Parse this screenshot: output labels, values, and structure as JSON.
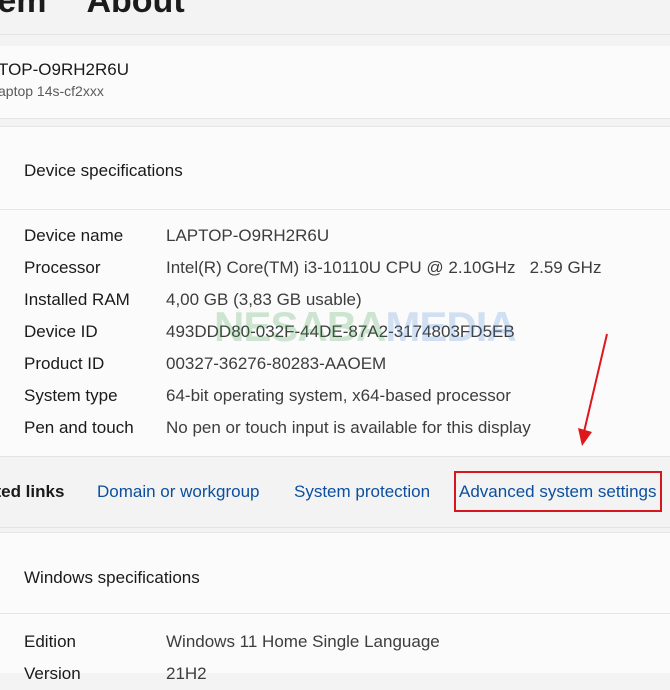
{
  "header": {
    "breadcrumb_parent": "tem",
    "breadcrumb_current": "About"
  },
  "device": {
    "name": "TOP-O9RH2R6U",
    "model": "aptop 14s-cf2xxx"
  },
  "device_specs": {
    "title": "Device specifications",
    "rows": [
      {
        "label": "Device name",
        "value": "LAPTOP-O9RH2R6U"
      },
      {
        "label": "Processor",
        "value": "Intel(R) Core(TM) i3-10110U CPU @ 2.10GHz   2.59 GHz"
      },
      {
        "label": "Installed RAM",
        "value": "4,00 GB (3,83 GB usable)"
      },
      {
        "label": "Device ID",
        "value": "493DDD80-032F-44DE-87A2-3174803FD5EB"
      },
      {
        "label": "Product ID",
        "value": "00327-36276-80283-AAOEM"
      },
      {
        "label": "System type",
        "value": "64-bit operating system, x64-based processor"
      },
      {
        "label": "Pen and touch",
        "value": "No pen or touch input is available for this display"
      }
    ]
  },
  "watermark": {
    "part1": "NESABA",
    "part2": "MEDIA"
  },
  "related": {
    "label": "ated links",
    "links": [
      "Domain or workgroup",
      "System protection",
      "Advanced system settings"
    ]
  },
  "windows_specs": {
    "title": "Windows specifications",
    "rows": [
      {
        "label": "Edition",
        "value": "Windows 11 Home Single Language"
      },
      {
        "label": "Version",
        "value": "21H2"
      }
    ]
  },
  "colors": {
    "link": "#0b4f9e",
    "highlight": "#d8161d",
    "arrow": "#e0161c"
  }
}
